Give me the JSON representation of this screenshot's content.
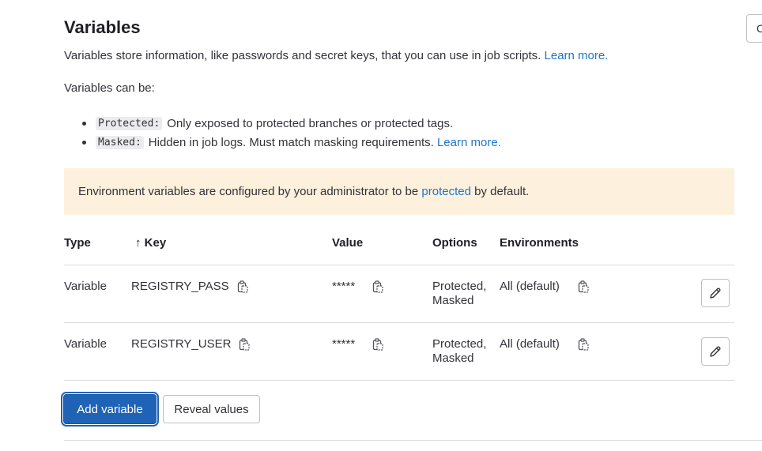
{
  "header": {
    "title": "Variables",
    "description": "Variables store information, like passwords and secret keys, that you can use in job scripts.",
    "learn_more": "Learn more.",
    "can_be": "Variables can be:",
    "corner_button_label": "C"
  },
  "bullets": [
    {
      "tag": "Protected:",
      "text": "Only exposed to protected branches or protected tags.",
      "link": ""
    },
    {
      "tag": "Masked:",
      "text": "Hidden in job logs. Must match masking requirements.",
      "link": "Learn more."
    }
  ],
  "alert": {
    "before": "Environment variables are configured by your administrator to be",
    "link": "protected",
    "after": "by default."
  },
  "table": {
    "columns": {
      "type": "Type",
      "sort_arrow": "↑",
      "key": "Key",
      "value": "Value",
      "options": "Options",
      "environments": "Environments"
    },
    "rows": [
      {
        "type": "Variable",
        "key": "REGISTRY_PASS",
        "value": "*****",
        "options_line1": "Protected,",
        "options_line2": "Masked",
        "environment": "All (default)"
      },
      {
        "type": "Variable",
        "key": "REGISTRY_USER",
        "value": "*****",
        "options_line1": "Protected,",
        "options_line2": "Masked",
        "environment": "All (default)"
      }
    ]
  },
  "actions": {
    "add_variable": "Add variable",
    "reveal_values": "Reveal values"
  },
  "colors": {
    "link": "#1f75cb",
    "primary": "#1f63b6",
    "alert_bg": "#fdf1dd"
  },
  "icons": {
    "copy": "copy-to-clipboard-icon",
    "edit": "pencil-icon"
  }
}
